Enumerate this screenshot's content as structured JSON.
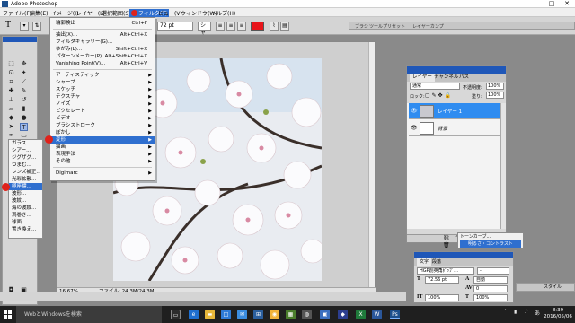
{
  "app": {
    "title": "Adobe Photoshop"
  },
  "window_controls": [
    "–",
    "□",
    "✕"
  ],
  "menubar": [
    {
      "label": "ファイル(F)"
    },
    {
      "label": "編集(E)"
    },
    {
      "label": "イメージ(I)"
    },
    {
      "label": "レイヤー(L)"
    },
    {
      "label": "選択範囲(S)"
    },
    {
      "label": "フィルタ(T)",
      "active": true
    },
    {
      "label": "ビュー(V)"
    },
    {
      "label": "ウィンドウ(W)"
    },
    {
      "label": "ヘルプ(H)"
    }
  ],
  "options_bar": {
    "tool_icon": "text-tool-icon",
    "font_family": "HGP創英角ﾎﾟｯﾌﾟ体",
    "font_size": "72 pt",
    "antialias": "シャープ",
    "text_color": "#e8141a"
  },
  "palette_well": {
    "tabs": [
      "ブラシ",
      "ツールプリセット",
      "レイヤーカンプ"
    ]
  },
  "filter_menu": {
    "items": [
      {
        "label": "輪郭検出",
        "shortcut": "Ctrl+F"
      },
      {
        "sep": true
      },
      {
        "label": "抽出(X)...",
        "shortcut": "Alt+Ctrl+X"
      },
      {
        "label": "フィルタギャラリー(G)..."
      },
      {
        "label": "ゆがみ(L)...",
        "shortcut": "Shift+Ctrl+X"
      },
      {
        "label": "パターンメーカー(P)...",
        "shortcut": "Alt+Shift+Ctrl+X"
      },
      {
        "label": "Vanishing Point(V)...",
        "shortcut": "Alt+Ctrl+V"
      },
      {
        "sep": true
      },
      {
        "label": "アーティスティック",
        "sub": true
      },
      {
        "label": "シャープ",
        "sub": true
      },
      {
        "label": "スケッチ",
        "sub": true
      },
      {
        "label": "テクスチャ",
        "sub": true
      },
      {
        "label": "ノイズ",
        "sub": true
      },
      {
        "label": "ピクセレート",
        "sub": true
      },
      {
        "label": "ビデオ",
        "sub": true
      },
      {
        "label": "ブラシストローク",
        "sub": true
      },
      {
        "label": "ぼかし",
        "sub": true
      },
      {
        "label": "変形",
        "sub": true,
        "highlighted": true,
        "marked": true
      },
      {
        "label": "描画",
        "sub": true
      },
      {
        "label": "表現手法",
        "sub": true
      },
      {
        "label": "その他",
        "sub": true
      },
      {
        "sep": true
      },
      {
        "label": "Digimarc",
        "sub": true
      }
    ]
  },
  "distort_submenu": {
    "items": [
      {
        "label": "ガラス..."
      },
      {
        "label": "シアー..."
      },
      {
        "label": "ジグザグ..."
      },
      {
        "label": "つまむ..."
      },
      {
        "label": "レンズ補正..."
      },
      {
        "label": "光彩拡散..."
      },
      {
        "label": "極座標...",
        "highlighted": true,
        "marked": true
      },
      {
        "label": "波形..."
      },
      {
        "label": "波紋..."
      },
      {
        "label": "海の波紋..."
      },
      {
        "label": "渦巻き..."
      },
      {
        "label": "球面..."
      },
      {
        "label": "置き換え..."
      }
    ]
  },
  "document": {
    "zoom": "16.67%",
    "info": "ファイル: 24.3M/24.3M"
  },
  "layers_panel": {
    "tabs": [
      "レイヤー",
      "チャンネル",
      "パス"
    ],
    "blend_mode": "通常",
    "opacity_label": "不透明度:",
    "opacity": "100%",
    "lock_label": "ロック:",
    "fill_label": "塗り:",
    "fill": "100%",
    "layers": [
      {
        "name": "レイヤー 1",
        "selected": true,
        "thumb": "photo"
      },
      {
        "name": "背景",
        "selected": false,
        "thumb": "white"
      }
    ],
    "footer_icons": "⛓ fx ◐ ▭ ❏ 🗑"
  },
  "adjust_popup": {
    "line1": "トーンカーブ...",
    "line2": "明るさ・コントラスト"
  },
  "character_panel": {
    "tabs": [
      "文字",
      "段落"
    ],
    "font_family": "HGP創英角ﾎﾟｯﾌﾟ...",
    "font_style": "-",
    "size": "72.56 pt",
    "leading": "自動",
    "tracking": "0",
    "scale_v": "100%",
    "scale_h": "100%"
  },
  "style_tab": {
    "label": "スタイル"
  },
  "taskbar": {
    "search_placeholder": "WebとWindowsを検索",
    "time": "8:39",
    "date": "2016/05/06"
  }
}
